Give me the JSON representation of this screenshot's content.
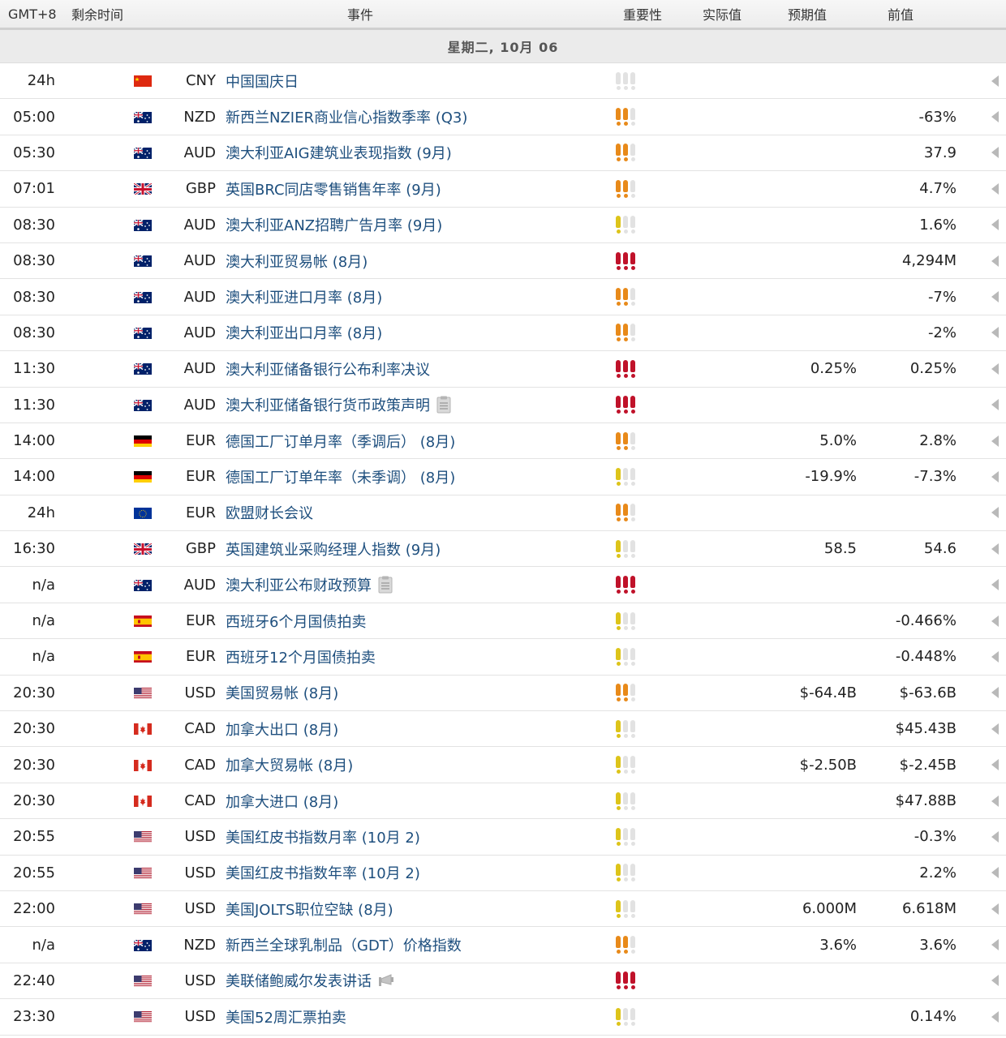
{
  "header": {
    "timezone": "GMT+8",
    "remaining": "剩余时间",
    "event": "事件",
    "importance": "重要性",
    "actual": "实际值",
    "forecast": "预期值",
    "previous": "前值"
  },
  "day_label": "星期二, 10月 06",
  "colors": {
    "high": "#c0122a",
    "medium": "#e88a1a",
    "low": "#ddc41a",
    "none": "#e2e2e2",
    "event_text": "#1e4f7e"
  },
  "rows": [
    {
      "time": "24h",
      "flag": "cn",
      "currency": "CNY",
      "event": "中国国庆日",
      "importance": 0,
      "actual": "",
      "forecast": "",
      "previous": ""
    },
    {
      "time": "05:00",
      "flag": "au",
      "currency": "NZD",
      "event": "新西兰NZIER商业信心指数季率 (Q3)",
      "importance": 2,
      "actual": "",
      "forecast": "",
      "previous": "-63%"
    },
    {
      "time": "05:30",
      "flag": "au",
      "currency": "AUD",
      "event": "澳大利亚AIG建筑业表现指数 (9月)",
      "importance": 2,
      "actual": "",
      "forecast": "",
      "previous": "37.9"
    },
    {
      "time": "07:01",
      "flag": "gb",
      "currency": "GBP",
      "event": "英国BRC同店零售销售年率 (9月)",
      "importance": 2,
      "actual": "",
      "forecast": "",
      "previous": "4.7%"
    },
    {
      "time": "08:30",
      "flag": "au",
      "currency": "AUD",
      "event": "澳大利亚ANZ招聘广告月率 (9月)",
      "importance": 1,
      "actual": "",
      "forecast": "",
      "previous": "1.6%"
    },
    {
      "time": "08:30",
      "flag": "au",
      "currency": "AUD",
      "event": "澳大利亚贸易帐 (8月)",
      "importance": 3,
      "actual": "",
      "forecast": "",
      "previous": "4,294M"
    },
    {
      "time": "08:30",
      "flag": "au",
      "currency": "AUD",
      "event": "澳大利亚进口月率 (8月)",
      "importance": 2,
      "actual": "",
      "forecast": "",
      "previous": "-7%"
    },
    {
      "time": "08:30",
      "flag": "au",
      "currency": "AUD",
      "event": "澳大利亚出口月率 (8月)",
      "importance": 2,
      "actual": "",
      "forecast": "",
      "previous": "-2%"
    },
    {
      "time": "11:30",
      "flag": "au",
      "currency": "AUD",
      "event": "澳大利亚储备银行公布利率决议",
      "importance": 3,
      "actual": "",
      "forecast": "0.25%",
      "previous": "0.25%"
    },
    {
      "time": "11:30",
      "flag": "au",
      "currency": "AUD",
      "event": "澳大利亚储备银行货币政策声明",
      "importance": 3,
      "actual": "",
      "forecast": "",
      "previous": "",
      "icon": "document-icon"
    },
    {
      "time": "14:00",
      "flag": "de",
      "currency": "EUR",
      "event": "德国工厂订单月率（季调后） (8月)",
      "importance": 2,
      "actual": "",
      "forecast": "5.0%",
      "previous": "2.8%"
    },
    {
      "time": "14:00",
      "flag": "de",
      "currency": "EUR",
      "event": "德国工厂订单年率（未季调） (8月)",
      "importance": 1,
      "actual": "",
      "forecast": "-19.9%",
      "previous": "-7.3%"
    },
    {
      "time": "24h",
      "flag": "eu",
      "currency": "EUR",
      "event": "欧盟财长会议",
      "importance": 2,
      "actual": "",
      "forecast": "",
      "previous": ""
    },
    {
      "time": "16:30",
      "flag": "gb",
      "currency": "GBP",
      "event": "英国建筑业采购经理人指数 (9月)",
      "importance": 1,
      "actual": "",
      "forecast": "58.5",
      "previous": "54.6"
    },
    {
      "time": "n/a",
      "flag": "au",
      "currency": "AUD",
      "event": "澳大利亚公布财政预算",
      "importance": 3,
      "actual": "",
      "forecast": "",
      "previous": "",
      "icon": "document-icon"
    },
    {
      "time": "n/a",
      "flag": "es",
      "currency": "EUR",
      "event": "西班牙6个月国债拍卖",
      "importance": 1,
      "actual": "",
      "forecast": "",
      "previous": "-0.466%"
    },
    {
      "time": "n/a",
      "flag": "es",
      "currency": "EUR",
      "event": "西班牙12个月国债拍卖",
      "importance": 1,
      "actual": "",
      "forecast": "",
      "previous": "-0.448%"
    },
    {
      "time": "20:30",
      "flag": "us",
      "currency": "USD",
      "event": "美国贸易帐 (8月)",
      "importance": 2,
      "actual": "",
      "forecast": "$-64.4B",
      "previous": "$-63.6B"
    },
    {
      "time": "20:30",
      "flag": "ca",
      "currency": "CAD",
      "event": "加拿大出口 (8月)",
      "importance": 1,
      "actual": "",
      "forecast": "",
      "previous": "$45.43B"
    },
    {
      "time": "20:30",
      "flag": "ca",
      "currency": "CAD",
      "event": "加拿大贸易帐 (8月)",
      "importance": 1,
      "actual": "",
      "forecast": "$-2.50B",
      "previous": "$-2.45B"
    },
    {
      "time": "20:30",
      "flag": "ca",
      "currency": "CAD",
      "event": "加拿大进口 (8月)",
      "importance": 1,
      "actual": "",
      "forecast": "",
      "previous": "$47.88B"
    },
    {
      "time": "20:55",
      "flag": "us",
      "currency": "USD",
      "event": "美国红皮书指数月率 (10月 2)",
      "importance": 1,
      "actual": "",
      "forecast": "",
      "previous": "-0.3%"
    },
    {
      "time": "20:55",
      "flag": "us",
      "currency": "USD",
      "event": "美国红皮书指数年率 (10月 2)",
      "importance": 1,
      "actual": "",
      "forecast": "",
      "previous": "2.2%"
    },
    {
      "time": "22:00",
      "flag": "us",
      "currency": "USD",
      "event": "美国JOLTS职位空缺 (8月)",
      "importance": 1,
      "actual": "",
      "forecast": "6.000M",
      "previous": "6.618M"
    },
    {
      "time": "n/a",
      "flag": "au",
      "currency": "NZD",
      "event": "新西兰全球乳制品（GDT）价格指数",
      "importance": 2,
      "actual": "",
      "forecast": "3.6%",
      "previous": "3.6%"
    },
    {
      "time": "22:40",
      "flag": "us",
      "currency": "USD",
      "event": "美联储鲍威尔发表讲话",
      "importance": 3,
      "actual": "",
      "forecast": "",
      "previous": "",
      "icon": "speech-icon"
    },
    {
      "time": "23:30",
      "flag": "us",
      "currency": "USD",
      "event": "美国52周汇票拍卖",
      "importance": 1,
      "actual": "",
      "forecast": "",
      "previous": "0.14%"
    }
  ]
}
